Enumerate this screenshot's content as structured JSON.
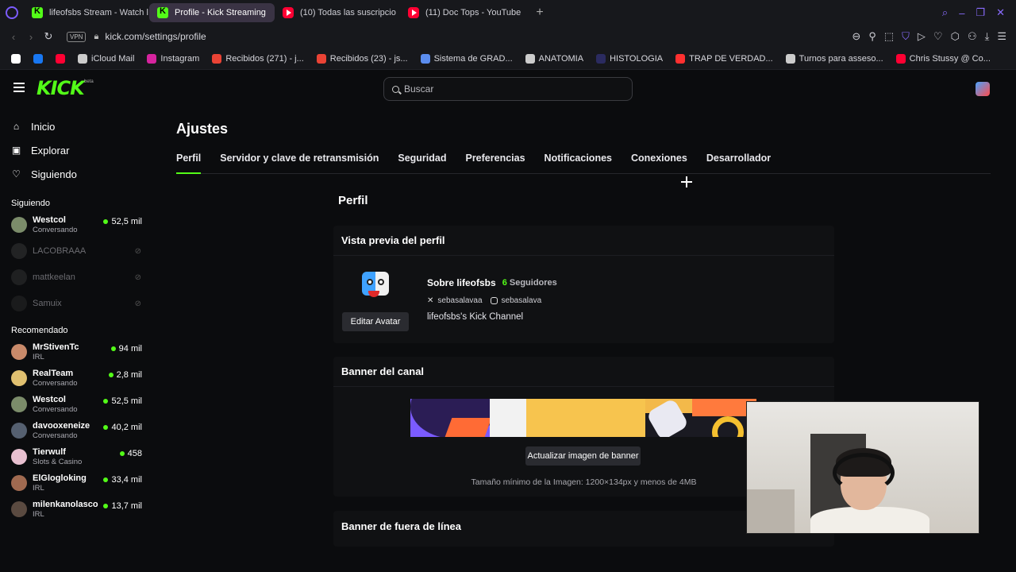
{
  "browser": {
    "tabs": [
      {
        "label": "lifeofsbs Stream - Watch l",
        "favicon": "kick-icon",
        "active": false
      },
      {
        "label": "Profile - Kick Streaming",
        "favicon": "kick-icon",
        "active": true
      },
      {
        "label": "(10) Todas las suscripcio",
        "favicon": "youtube-icon",
        "active": false
      },
      {
        "label": "(11) Doc Tops - YouTube",
        "favicon": "youtube-icon",
        "active": false
      }
    ],
    "new_tab": "+",
    "url": "kick.com/settings/profile",
    "vpn_label": "VPN",
    "bookmarks": [
      {
        "label": "",
        "icon": "x-icon",
        "color": "#ffffff"
      },
      {
        "label": "",
        "icon": "facebook-icon",
        "color": "#1877f2"
      },
      {
        "label": "",
        "icon": "youtube-icon",
        "color": "#ff0033"
      },
      {
        "label": "iCloud Mail",
        "icon": "apple-icon",
        "color": "#cccccc"
      },
      {
        "label": "Instagram",
        "icon": "instagram-icon",
        "color": "#d6249f"
      },
      {
        "label": "Recibidos (271) - j...",
        "icon": "gmail-icon",
        "color": "#ea4335"
      },
      {
        "label": "Recibidos (23) - js...",
        "icon": "gmail-icon",
        "color": "#ea4335"
      },
      {
        "label": "Sistema de GRAD...",
        "icon": "globe-icon",
        "color": "#5b8def"
      },
      {
        "label": "ANATOMIA",
        "icon": "chatgpt-icon",
        "color": "#cccccc"
      },
      {
        "label": "HISTOLOGIA",
        "icon": "folder-icon",
        "color": "#2b2b60"
      },
      {
        "label": "TRAP DE VERDAD...",
        "icon": "red-icon",
        "color": "#ff3030"
      },
      {
        "label": "Turnos para asseso...",
        "icon": "page-icon",
        "color": "#cccccc"
      },
      {
        "label": "Chris Stussy @ Co...",
        "icon": "youtube-icon",
        "color": "#ff0033"
      }
    ]
  },
  "kick": {
    "logo": "KICK",
    "logo_badge": "beta",
    "search_placeholder": "Buscar",
    "nav": [
      {
        "label": "Inicio",
        "icon": "home-icon",
        "glyph": "⌂"
      },
      {
        "label": "Explorar",
        "icon": "explore-icon",
        "glyph": "▣"
      },
      {
        "label": "Siguiendo",
        "icon": "heart-icon",
        "glyph": "♡"
      }
    ],
    "following_title": "Siguiendo",
    "following": [
      {
        "name": "Westcol",
        "category": "Conversando",
        "viewers": "52,5 mil",
        "live": true,
        "avatar": "#7b8c6a"
      },
      {
        "name": "LACOBRAAA",
        "category": "",
        "viewers": "",
        "live": false,
        "avatar": "#3a3a3a"
      },
      {
        "name": "mattkeelan",
        "category": "",
        "viewers": "",
        "live": false,
        "avatar": "#333333"
      },
      {
        "name": "Samuix",
        "category": "",
        "viewers": "",
        "live": false,
        "avatar": "#2a2a2a"
      }
    ],
    "recommended_title": "Recomendado",
    "recommended": [
      {
        "name": "MrStivenTc",
        "category": "IRL",
        "viewers": "94 mil",
        "live": true,
        "avatar": "#c98a6a"
      },
      {
        "name": "RealTeam",
        "category": "Conversando",
        "viewers": "2,8 mil",
        "live": true,
        "avatar": "#e0c070"
      },
      {
        "name": "Westcol",
        "category": "Conversando",
        "viewers": "52,5 mil",
        "live": true,
        "avatar": "#7b8c6a"
      },
      {
        "name": "davooxeneize",
        "category": "Conversando",
        "viewers": "40,2 mil",
        "live": true,
        "avatar": "#556070"
      },
      {
        "name": "Tierwulf",
        "category": "Slots & Casino",
        "viewers": "458",
        "live": true,
        "avatar": "#e8c0d0"
      },
      {
        "name": "ElGlogloking",
        "category": "IRL",
        "viewers": "33,4 mil",
        "live": true,
        "avatar": "#a06a50"
      },
      {
        "name": "milenkanolasco",
        "category": "IRL",
        "viewers": "13,7 mil",
        "live": true,
        "avatar": "#5a4a40"
      }
    ]
  },
  "settings": {
    "title": "Ajustes",
    "tabs": [
      "Perfil",
      "Servidor y clave de retransmisión",
      "Seguridad",
      "Preferencias",
      "Notificaciones",
      "Conexiones",
      "Desarrollador"
    ],
    "active_tab": "Perfil",
    "section_title": "Perfil",
    "preview": {
      "heading": "Vista previa del perfil",
      "edit_avatar": "Editar Avatar",
      "about_name": "Sobre lifeofsbs",
      "followers_count": "6",
      "followers_label": "Seguidores",
      "x_handle": "sebasalavaa",
      "ig_handle": "sebasalava",
      "bio": "lifeofsbs's Kick Channel"
    },
    "banner": {
      "heading": "Banner del canal",
      "update_button": "Actualizar imagen de banner",
      "note": "Tamaño mínimo de la Imagen: 1200×134px y menos de 4MB"
    },
    "offline_banner": {
      "heading": "Banner de fuera de línea"
    }
  },
  "colors": {
    "accent": "#53fc18",
    "background": "#0b0c0e",
    "browser_accent": "#7c5cff"
  }
}
